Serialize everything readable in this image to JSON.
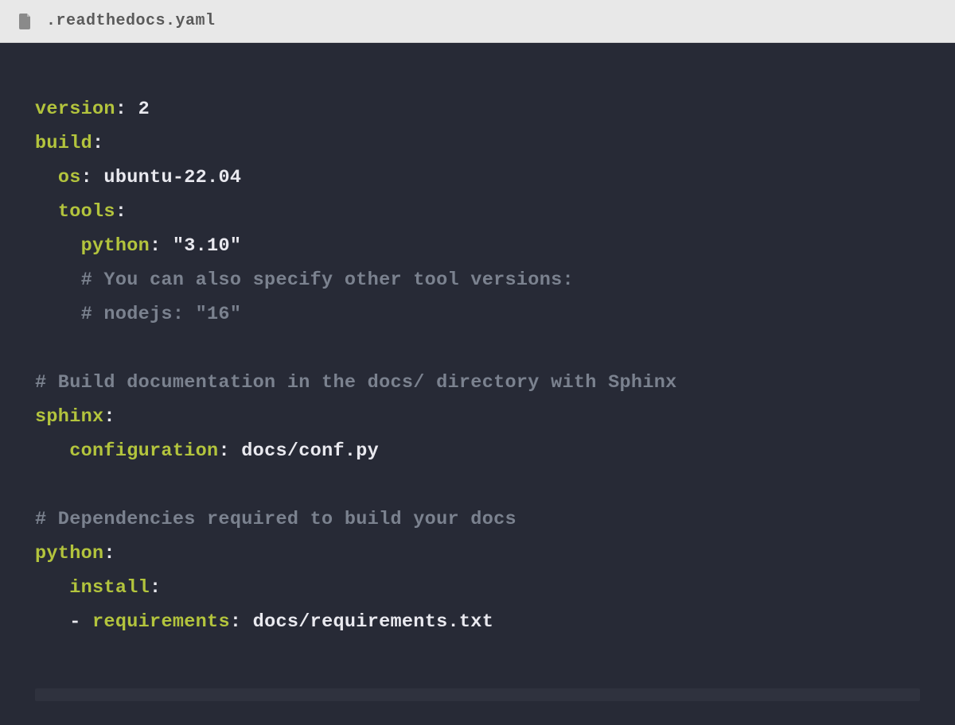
{
  "header": {
    "filename": ".readthedocs.yaml"
  },
  "code": {
    "l1_key": "version",
    "l1_colon": ":",
    "l1_value": " 2",
    "l2_key": "build",
    "l2_colon": ":",
    "l3_indent": "  ",
    "l3_key": "os",
    "l3_colon": ":",
    "l3_value": " ubuntu-22.04",
    "l4_indent": "  ",
    "l4_key": "tools",
    "l4_colon": ":",
    "l5_indent": "    ",
    "l5_key": "python",
    "l5_colon": ":",
    "l5_value": " \"3.10\"",
    "l6_indent": "    ",
    "l6_comment": "# You can also specify other tool versions:",
    "l7_indent": "    ",
    "l7_comment": "# nodejs: \"16\"",
    "blank1": "",
    "l8_comment": "# Build documentation in the docs/ directory with Sphinx",
    "l9_key": "sphinx",
    "l9_colon": ":",
    "l10_indent": "   ",
    "l10_key": "configuration",
    "l10_colon": ":",
    "l10_value": " docs/conf.py",
    "blank2": "",
    "l11_comment": "# Dependencies required to build your docs",
    "l12_key": "python",
    "l12_colon": ":",
    "l13_indent": "   ",
    "l13_key": "install",
    "l13_colon": ":",
    "l14_indent": "   ",
    "l14_dash": "- ",
    "l14_key": "requirements",
    "l14_colon": ":",
    "l14_value": " docs/requirements.txt"
  }
}
